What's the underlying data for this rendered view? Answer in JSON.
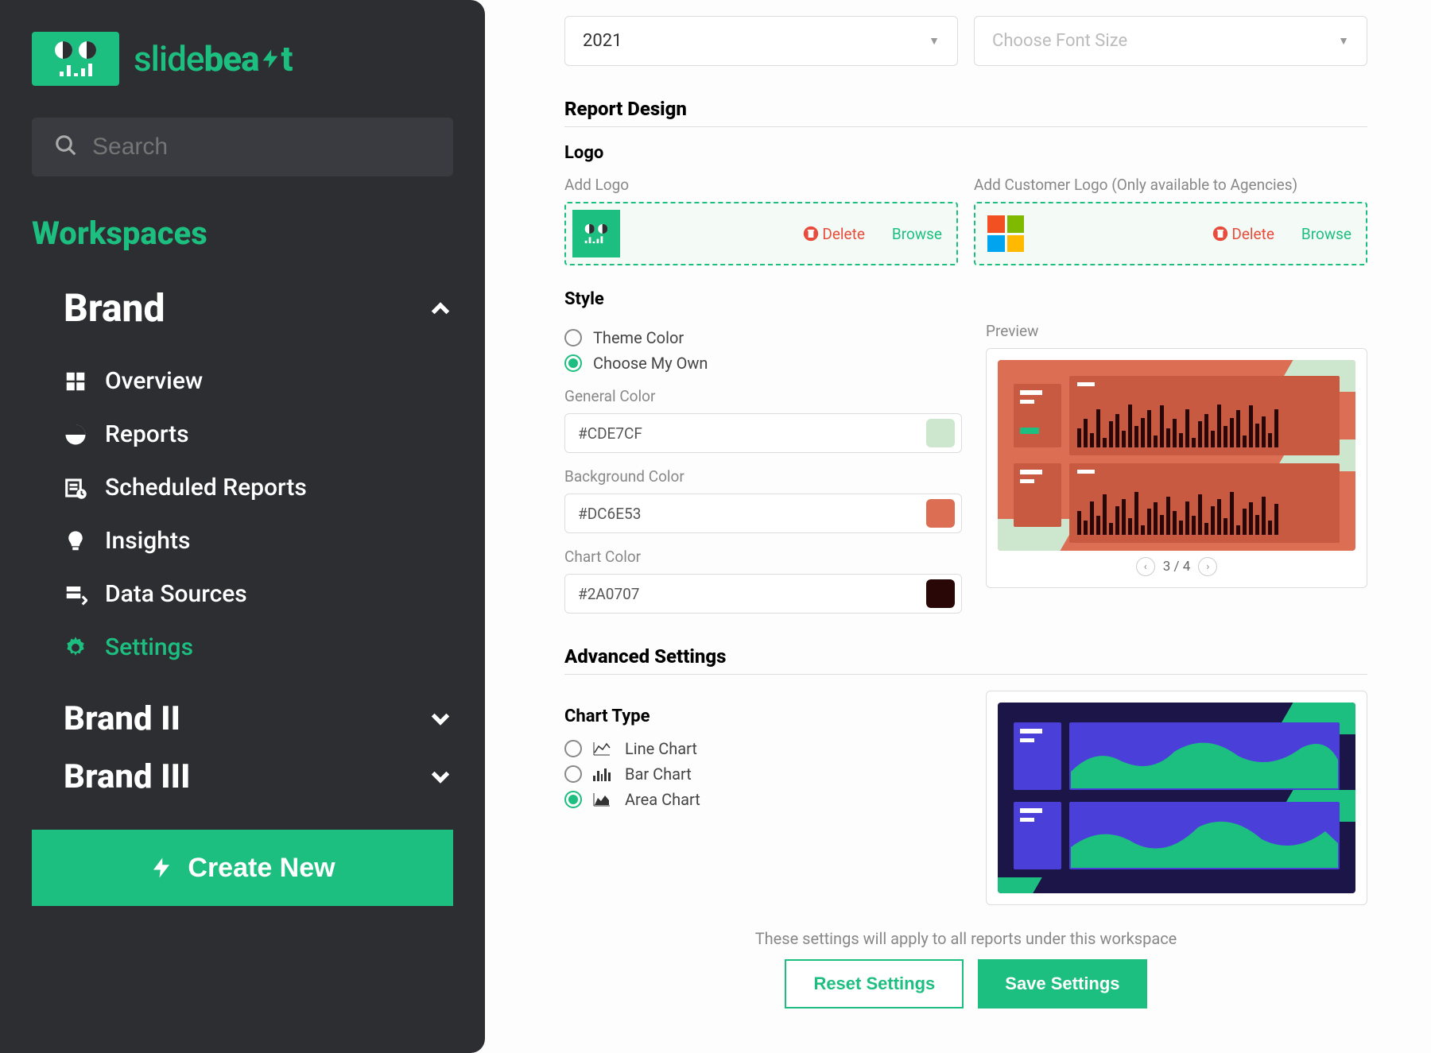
{
  "brand": {
    "name_part1": "slide",
    "name_part2": "bea",
    "name_part3": "t"
  },
  "search": {
    "placeholder": "Search"
  },
  "workspaces": {
    "title": "Workspaces",
    "items": [
      {
        "label": "Brand",
        "expanded": true
      },
      {
        "label": "Brand II",
        "expanded": false
      },
      {
        "label": "Brand III",
        "expanded": false
      }
    ]
  },
  "nav": {
    "items": [
      {
        "label": "Overview"
      },
      {
        "label": "Reports"
      },
      {
        "label": "Scheduled Reports"
      },
      {
        "label": "Insights"
      },
      {
        "label": "Data Sources"
      },
      {
        "label": "Settings",
        "active": true
      }
    ]
  },
  "create_label": "Create New",
  "top_selects": {
    "year": "2021",
    "font_placeholder": "Choose Font Size"
  },
  "sections": {
    "report_design": "Report Design",
    "logo": "Logo",
    "style": "Style",
    "advanced": "Advanced Settings",
    "chart_type": "Chart Type"
  },
  "logo_section": {
    "add_logo_label": "Add Logo",
    "add_customer_logo_label": "Add Customer Logo (Only available to Agencies)",
    "delete": "Delete",
    "browse": "Browse"
  },
  "style_section": {
    "theme_color_label": "Theme Color",
    "choose_own_label": "Choose My Own",
    "selected_mode": "choose_own",
    "general_color": {
      "label": "General Color",
      "value": "#CDE7CF"
    },
    "background_color": {
      "label": "Background Color",
      "value": "#DC6E53"
    },
    "chart_color": {
      "label": "Chart Color",
      "value": "#2A0707"
    },
    "preview_label": "Preview",
    "pager": "3 / 4"
  },
  "chart_types": {
    "options": [
      {
        "label": "Line Chart",
        "selected": false
      },
      {
        "label": "Bar Chart",
        "selected": false
      },
      {
        "label": "Area Chart",
        "selected": true
      }
    ]
  },
  "footer": {
    "note": "These settings will apply to all reports under this workspace",
    "reset": "Reset Settings",
    "save": "Save Settings"
  }
}
